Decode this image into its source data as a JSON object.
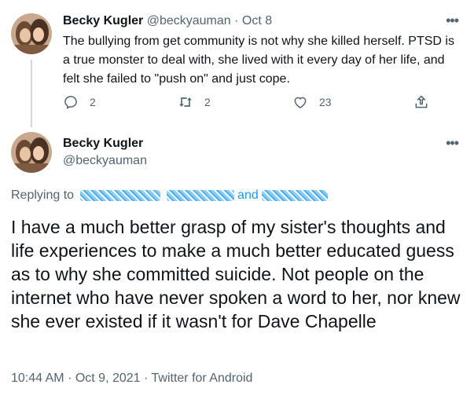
{
  "tweet1": {
    "name": "Becky Kugler",
    "handle": "@beckyauman",
    "separator": "·",
    "date": "Oct 8",
    "more_icon": "more-icon",
    "text": "The bullying from get community is not why she killed herself. PTSD is a true monster to deal with, she lived with it every day of her life, and felt she failed to \"push on\" and just cope.",
    "actions": {
      "reply_count": "2",
      "retweet_count": "2",
      "like_count": "23"
    }
  },
  "tweet2": {
    "name": "Becky Kugler",
    "handle": "@beckyauman",
    "replying_prefix": "Replying to",
    "replying_and": "and",
    "text": "I have a much better grasp of my sister's thoughts and life experiences to make a much better educated guess as to why she committed suicide. Not people on the internet who have never spoken a word to her, nor knew she ever existed if it wasn't for Dave Chapelle",
    "time": "10:44 AM",
    "separator": "·",
    "date": "Oct 9, 2021",
    "source": "Twitter for Android"
  },
  "colors": {
    "text": "#0f1419",
    "secondary": "#536471",
    "link": "#1d9bf0",
    "thread_line": "#cfd9de"
  }
}
